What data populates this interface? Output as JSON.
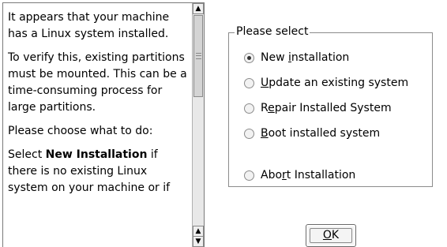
{
  "help": {
    "para1": "It appears that your machine has a Linux system installed.",
    "para2": "To verify this, existing partitions must be mounted. This can be a time-consuming process for large partitions.",
    "para3": "Please choose what to do:",
    "para4_prefix": "Select ",
    "para4_bold": "New Installation",
    "para4_suffix": " if there is no existing Linux system on your machine or if"
  },
  "options": {
    "legend": "Please select",
    "items": [
      {
        "pre": "New ",
        "mnemonic": "i",
        "post": "nstallation",
        "checked": true
      },
      {
        "pre": "",
        "mnemonic": "U",
        "post": "pdate an existing system",
        "checked": false
      },
      {
        "pre": "R",
        "mnemonic": "e",
        "post": "pair Installed System",
        "checked": false
      },
      {
        "pre": "",
        "mnemonic": "B",
        "post": "oot installed system",
        "checked": false
      },
      {
        "pre": "Abo",
        "mnemonic": "r",
        "post": "t Installation",
        "checked": false
      }
    ]
  },
  "ok_button": {
    "mnemonic": "O",
    "rest": "K"
  }
}
